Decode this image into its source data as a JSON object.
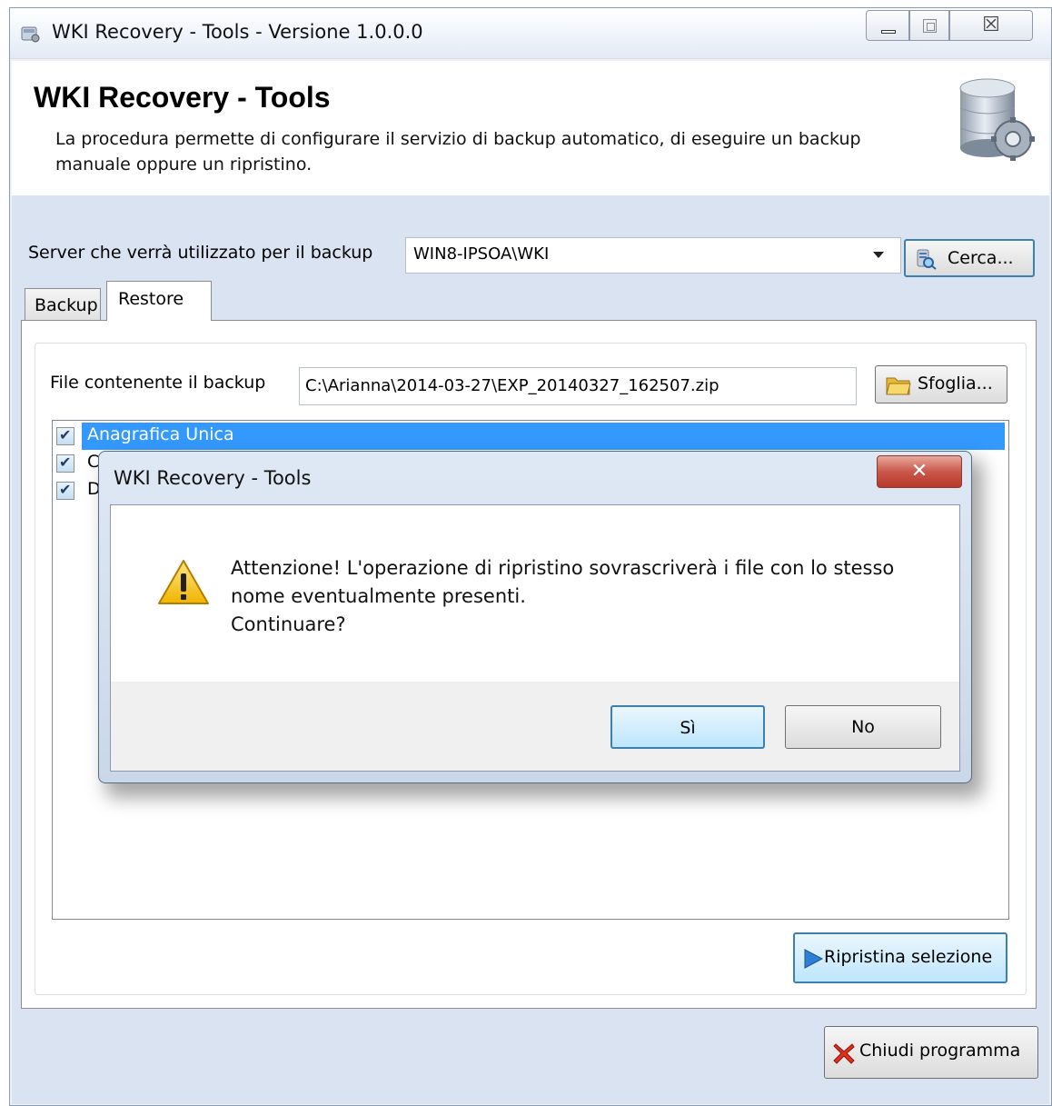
{
  "window": {
    "title": "WKI Recovery - Tools - Versione 1.0.0.0",
    "close_glyph": "☒"
  },
  "header": {
    "title": "WKI Recovery - Tools",
    "description": "La procedura permette di configurare il servizio di backup automatico, di eseguire un backup manuale oppure un ripristino."
  },
  "server": {
    "label": "Server che verrà utilizzato per il backup",
    "value": "WIN8-IPSOA\\WKI",
    "search_label": "Cerca..."
  },
  "tabs": [
    {
      "label": "Backup"
    },
    {
      "label": "Restore"
    }
  ],
  "restore": {
    "file_label": "File contenente il backup",
    "file_value": "C:\\Arianna\\2014-03-27\\EXP_20140327_162507.zip",
    "browse_label": "Sfoglia...",
    "items": [
      {
        "label": "Anagrafica Unica",
        "checked": true
      },
      {
        "label": "C",
        "checked": true
      },
      {
        "label": "D",
        "checked": true
      }
    ],
    "restore_button": "Ripristina selezione"
  },
  "close_program_label": "Chiudi programma",
  "dialog": {
    "title": "WKI Recovery - Tools",
    "close_glyph": "✕",
    "message_line1": "Attenzione! L'operazione di ripristino sovrascriverà i file con lo stesso",
    "message_line2": "nome eventualmente presenti.",
    "message_line3": "Continuare?",
    "yes_label": "Sì",
    "no_label": "No"
  },
  "colors": {
    "selection": "#3399ff",
    "content_bg": "#d9e3f1",
    "dialog_close": "#c9584a",
    "default_button_border": "#3c7fb1"
  },
  "icons": [
    "app-icon",
    "database-gear-icon",
    "server-search-icon",
    "folder-icon",
    "play-arrow-icon",
    "red-x-icon",
    "warning-icon"
  ]
}
